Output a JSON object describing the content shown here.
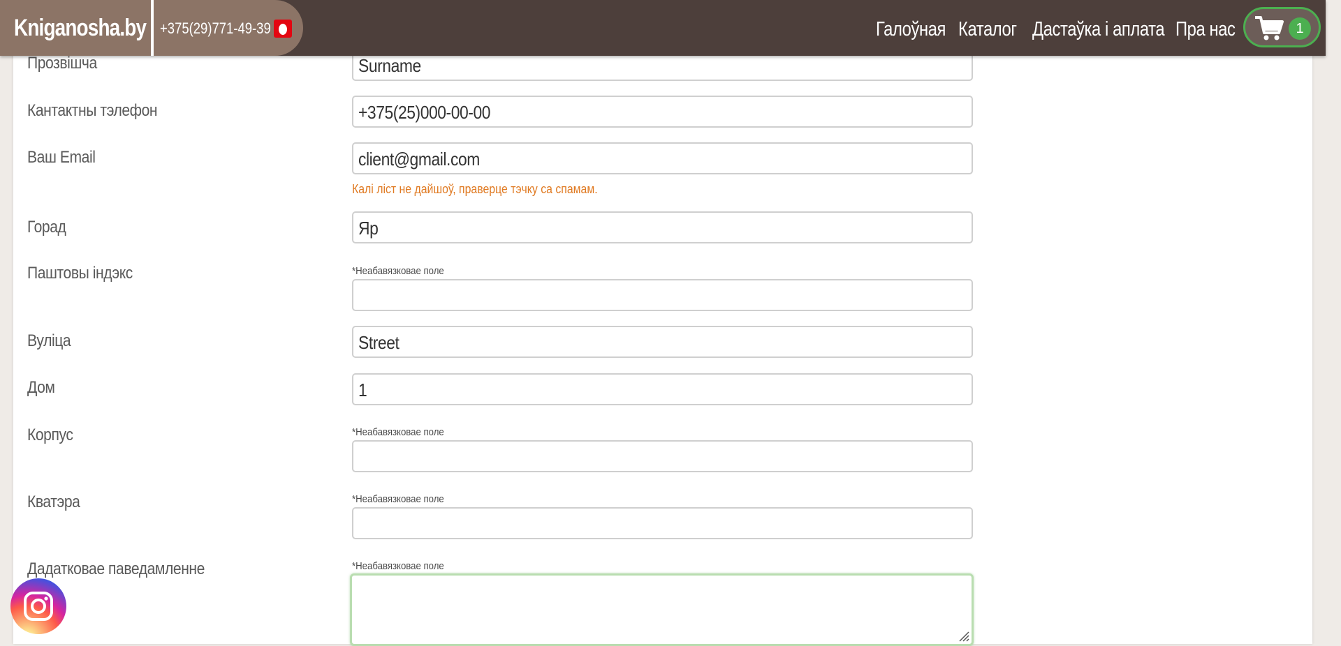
{
  "header": {
    "logo": "Kniganosha.by",
    "phone": "+375(29)771-49-39",
    "phone_operator_icon": "mts-egg-icon",
    "nav": [
      {
        "label": "Галоўная"
      },
      {
        "label": "Каталог"
      },
      {
        "label": "Дастаўка і аплата"
      },
      {
        "label": "Пра нас"
      }
    ],
    "cart": {
      "icon": "cart-icon",
      "count": "1"
    }
  },
  "form": {
    "fields": [
      {
        "label": "Прозвішча",
        "value": "Surname"
      },
      {
        "label": "Кантактны тэлефон",
        "value": "+375(25)000-00-00"
      },
      {
        "label": "Ваш Email",
        "value": "client@gmail.com",
        "hint": "Калі ліст не дайшоў, праверце тэчку са спамам."
      },
      {
        "label": "Горад",
        "value": "Яр"
      },
      {
        "label": "Паштовы індэкс",
        "value": "",
        "note": "*Неабавязковае поле"
      },
      {
        "label": "Вуліца",
        "value": "Street"
      },
      {
        "label": "Дом",
        "value": "1"
      },
      {
        "label": "Корпус",
        "value": "",
        "note": "*Неабавязковае поле"
      },
      {
        "label": "Кватэра",
        "value": "",
        "note": "*Неабавязковае поле"
      },
      {
        "label": "Дадатковае паведамленне",
        "value": "",
        "note": "*Неабавязковае поле"
      }
    ]
  },
  "social": {
    "icon": "instagram-icon"
  },
  "colors": {
    "header_bg": "#4d3f3b",
    "brand_pill": "#8c7466",
    "accent_green": "#4caf50",
    "hint_orange": "#e07a22",
    "focus_border": "#b9ddb0"
  }
}
